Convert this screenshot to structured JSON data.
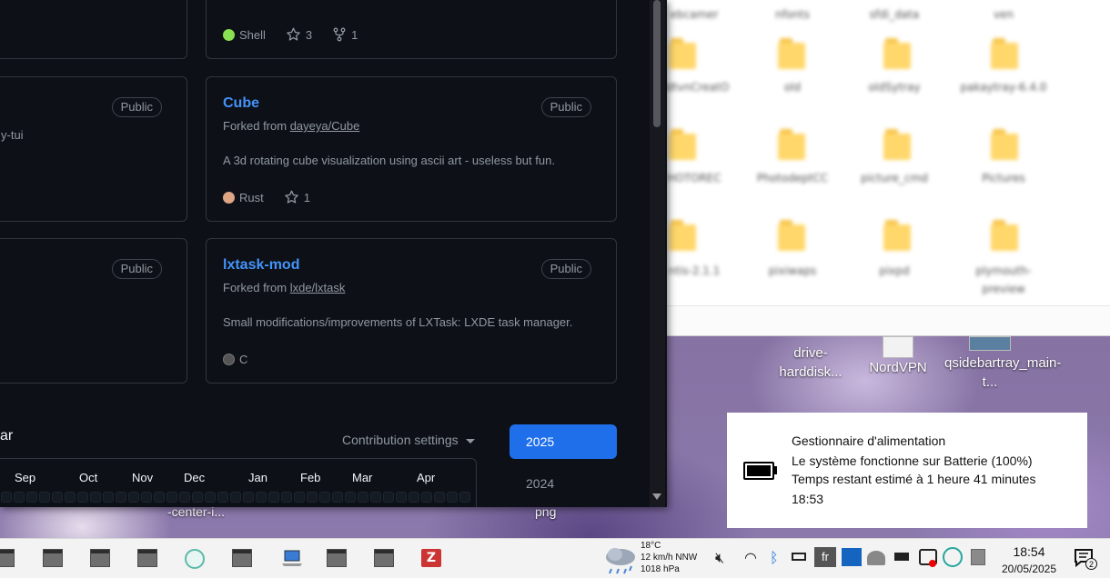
{
  "repos": {
    "top_right": {
      "language": "Shell",
      "language_color": "#89e051",
      "stars": "3",
      "forks": "1"
    },
    "left_partial_1": {
      "badge": "Public",
      "desc_fragment": "y-tui"
    },
    "left_partial_2": {
      "badge": "Public"
    },
    "cube": {
      "name": "Cube",
      "badge": "Public",
      "forked_prefix": "Forked from",
      "forked_link": "dayeya/Cube",
      "description": "A 3d rotating cube visualization using ascii art - useless but fun.",
      "language": "Rust",
      "language_color": "#dea584",
      "stars": "1"
    },
    "lxtask": {
      "name": "lxtask-mod",
      "badge": "Public",
      "forked_prefix": "Forked from",
      "forked_link": "lxde/lxtask",
      "description": "Small modifications/improvements of LXTask: LXDE task manager.",
      "language": "C",
      "language_color": "#555555"
    }
  },
  "contributions": {
    "title_fragment": "ar",
    "settings_label": "Contribution settings",
    "months": [
      "Sep",
      "Oct",
      "Nov",
      "Dec",
      "Jan",
      "Feb",
      "Mar",
      "Apr"
    ],
    "years": [
      "2025",
      "2024"
    ]
  },
  "desktop": {
    "icons": [
      "drive-harddisk...",
      "NordVPN",
      "qsidebartray_main-t..."
    ],
    "under_labels": [
      "-center-i...",
      "png"
    ]
  },
  "notification": {
    "title": "Gestionnaire d'alimentation",
    "line1": "Le système fonctionne sur Batterie (100%)",
    "line2": "Temps restant estimé à 1 heure 41 minutes",
    "time": "18:53"
  },
  "taskbar": {
    "weather": {
      "temp": "18°C",
      "wind": "12 km/h NNW",
      "pressure": "1018 hPa"
    },
    "language": "fr",
    "clock_time": "18:54",
    "clock_date": "20/05/2025",
    "notification_count": "2"
  },
  "colors": {
    "link": "#4493f8",
    "accent_button": "#1f6feb",
    "bg": "#0d1117"
  }
}
